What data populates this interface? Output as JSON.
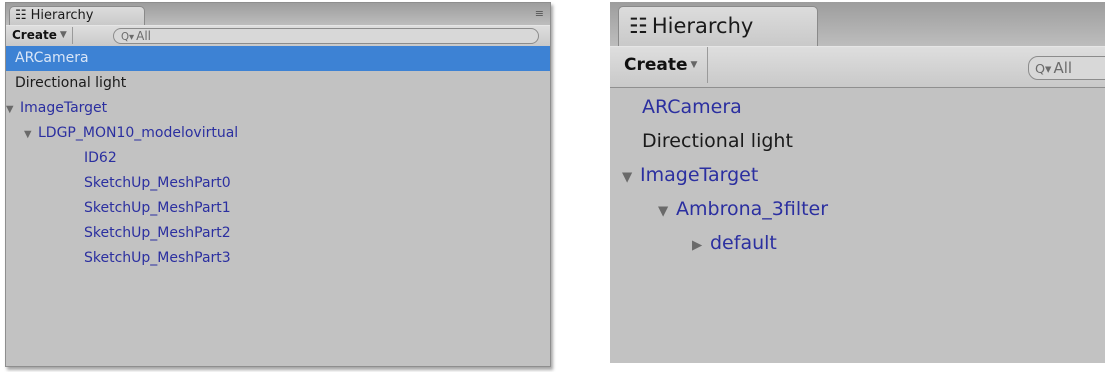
{
  "left": {
    "tab_icon": "☷",
    "tab_title": "Hierarchy",
    "panel_menu_icon": "≡",
    "create_label": "Create",
    "search_placeholder": "All",
    "rows": [
      {
        "label": "ARCamera",
        "selected": true
      },
      {
        "label": "Directional light"
      },
      {
        "label": "ImageTarget"
      },
      {
        "label": "LDGP_MON10_modelovirtual"
      },
      {
        "label": "ID62"
      },
      {
        "label": "SketchUp_MeshPart0"
      },
      {
        "label": "SketchUp_MeshPart1"
      },
      {
        "label": "SketchUp_MeshPart2"
      },
      {
        "label": "SketchUp_MeshPart3"
      }
    ]
  },
  "right": {
    "tab_icon": "☷",
    "tab_title": "Hierarchy",
    "create_label": "Create",
    "search_placeholder": "All",
    "rows": [
      {
        "label": "ARCamera"
      },
      {
        "label": "Directional light"
      },
      {
        "label": "ImageTarget"
      },
      {
        "label": "Ambrona_3filter"
      },
      {
        "label": "default"
      }
    ]
  },
  "colors": {
    "panel_bg": "#c2c2c2",
    "selection": "#3d82d4",
    "prefab_text": "#2b2fa0",
    "plain_text": "#1a1a1a"
  }
}
